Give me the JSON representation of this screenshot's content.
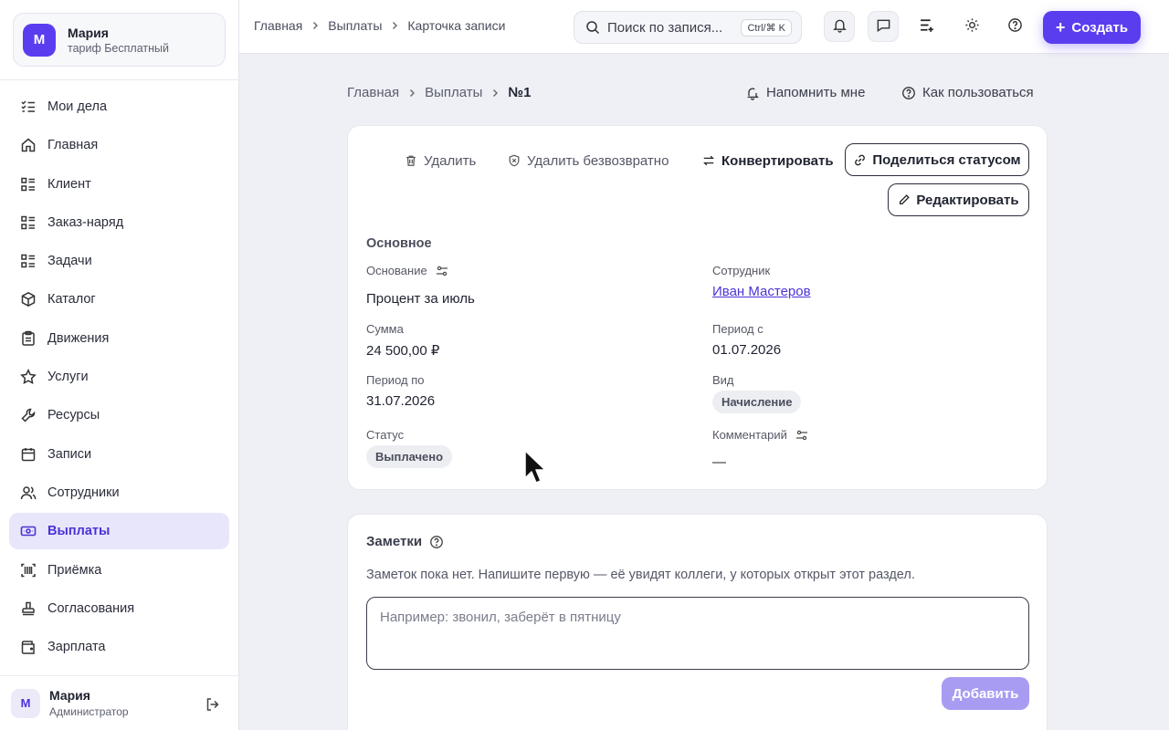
{
  "account": {
    "avatar_letter": "М",
    "name": "Мария",
    "plan": "тариф Бесплатный"
  },
  "sidebar": {
    "items": [
      {
        "label": "Мои дела",
        "icon": "checklist-icon"
      },
      {
        "label": "Главная",
        "icon": "home-icon"
      },
      {
        "label": "Клиент",
        "icon": "list-icon"
      },
      {
        "label": "Заказ-наряд",
        "icon": "list-icon"
      },
      {
        "label": "Задачи",
        "icon": "list-icon"
      },
      {
        "label": "Каталог",
        "icon": "box-icon"
      },
      {
        "label": "Движения",
        "icon": "clipboard-icon"
      },
      {
        "label": "Услуги",
        "icon": "star-icon"
      },
      {
        "label": "Ресурсы",
        "icon": "wrench-icon"
      },
      {
        "label": "Записи",
        "icon": "calendar-icon"
      },
      {
        "label": "Сотрудники",
        "icon": "users-icon"
      },
      {
        "label": "Выплаты",
        "icon": "banknote-icon",
        "active": true
      },
      {
        "label": "Приёмка",
        "icon": "scan-icon"
      },
      {
        "label": "Согласования",
        "icon": "stamp-icon"
      },
      {
        "label": "Зарплата",
        "icon": "wallet-icon"
      }
    ]
  },
  "footer_user": {
    "avatar_letter": "М",
    "name": "Мария",
    "role": "Администратор"
  },
  "topbar": {
    "breadcrumbs": [
      "Главная",
      "Выплаты",
      "Карточка записи"
    ],
    "search_placeholder": "Поиск по записям",
    "search_text": "Поиск по запися...",
    "shortcut": "Ctrl/⌘ K",
    "create_label": "Создать"
  },
  "page": {
    "breadcrumbs": [
      "Главная",
      "Выплаты",
      "№1"
    ],
    "remind_label": "Напомнить мне",
    "howto_label": "Как пользоваться"
  },
  "actions": {
    "delete": "Удалить",
    "delete_forever": "Удалить безвозвратно",
    "convert": "Конвертировать",
    "share_status": "Поделиться статусом",
    "edit": "Редактировать"
  },
  "record": {
    "section_title": "Основное",
    "fields": {
      "basis": {
        "label": "Основание",
        "value": "Процент за июль"
      },
      "employee": {
        "label": "Сотрудник",
        "value": "Иван Мастеров"
      },
      "amount": {
        "label": "Сумма",
        "value": "24 500,00 ₽"
      },
      "period_from": {
        "label": "Период с",
        "value": "01.07.2026"
      },
      "period_to": {
        "label": "Период по",
        "value": "31.07.2026"
      },
      "type": {
        "label": "Вид",
        "value": "Начисление"
      },
      "status": {
        "label": "Статус",
        "value": "Выплачено"
      },
      "comment": {
        "label": "Комментарий",
        "value": "—"
      }
    }
  },
  "notes": {
    "title": "Заметки",
    "empty_text": "Заметок пока нет. Напишите первую — её увидят коллеги, у которых открыт этот раздел.",
    "placeholder": "Например: звонил, заберёт в пятницу",
    "add_label": "Добавить"
  },
  "colors": {
    "accent": "#5b3df0",
    "active_bg": "#e8e6fb",
    "page_bg": "#eef0f5"
  }
}
